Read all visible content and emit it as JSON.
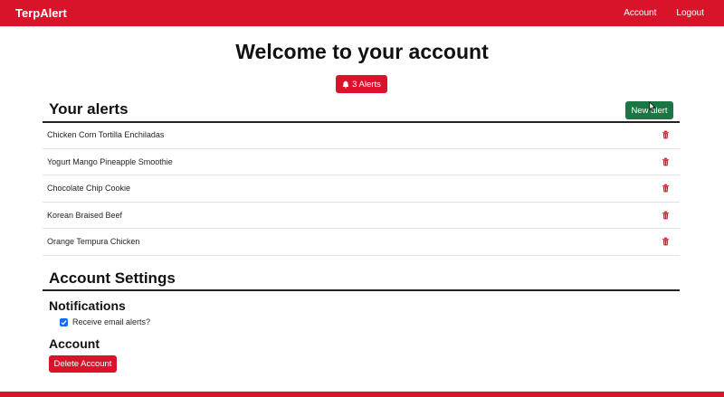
{
  "navbar": {
    "brand": "TerpAlert",
    "links": [
      "Account",
      "Logout"
    ]
  },
  "page": {
    "title": "Welcome to your account",
    "alerts_badge": "3 Alerts"
  },
  "alerts_section": {
    "title": "Your alerts",
    "new_alert_button": "New alert",
    "items": [
      "Chicken Corn Tortilla Enchiladas",
      "Yogurt Mango Pineapple Smoothie",
      "Chocolate Chip Cookie",
      "Korean Braised Beef",
      "Orange Tempura Chicken"
    ]
  },
  "settings": {
    "title": "Account Settings",
    "notifications_heading": "Notifications",
    "email_checkbox_label": "Receive email alerts?",
    "email_checkbox_checked": true,
    "account_heading": "Account",
    "delete_button": "Delete Account"
  },
  "colors": {
    "brand_red": "#d9142a",
    "success_green": "#1a7743",
    "checkbox_blue": "#0d6efd"
  },
  "icons": {
    "badge": "bell-icon",
    "row_action": "trash-icon",
    "pointer": "cursor-icon"
  }
}
